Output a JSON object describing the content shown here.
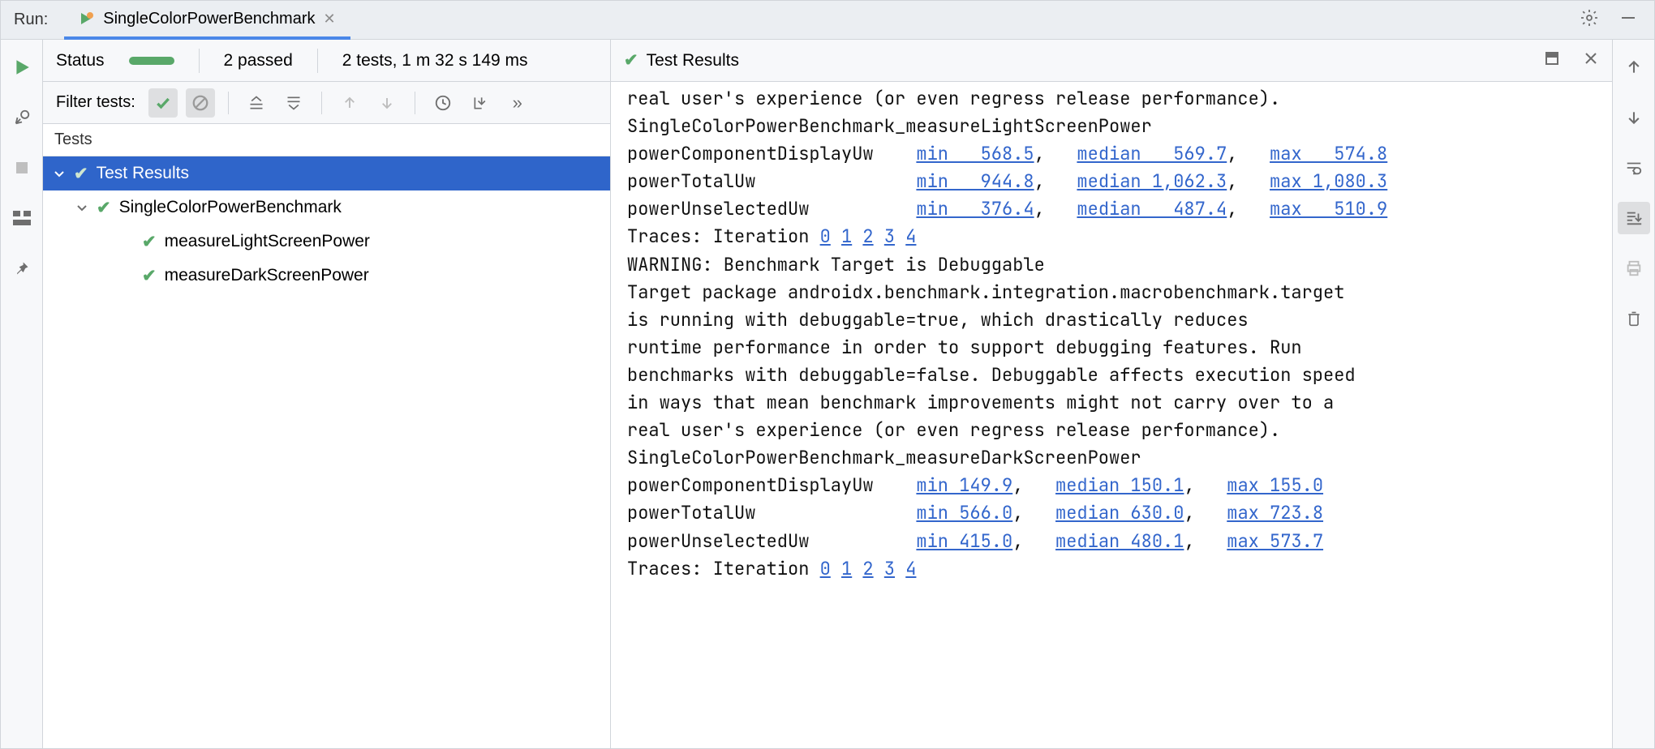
{
  "run_label": "Run:",
  "tab": {
    "title": "SingleColorPowerBenchmark"
  },
  "status": {
    "label": "Status",
    "passed": "2 passed",
    "summary": "2 tests, 1 m 32 s 149 ms"
  },
  "filter_label": "Filter tests:",
  "tests_header": "Tests",
  "tree": {
    "root": "Test Results",
    "suite": "SingleColorPowerBenchmark",
    "test1": "measureLightScreenPower",
    "test2": "measureDarkScreenPower"
  },
  "results_title": "Test Results",
  "console": {
    "intro_line": "real user's experience (or even regress release performance).",
    "light_name": "SingleColorPowerBenchmark_measureLightScreenPower",
    "light_metrics": [
      {
        "label": "powerComponentDisplayUw",
        "min": "min   568.5",
        "median": "median   569.7",
        "max": "max   574.8"
      },
      {
        "label": "powerTotalUw",
        "min": "min   944.8",
        "median": "median 1,062.3",
        "max": "max 1,080.3"
      },
      {
        "label": "powerUnselectedUw",
        "min": "min   376.4",
        "median": "median   487.4",
        "max": "max   510.9"
      }
    ],
    "traces_prefix": "Traces: Iteration ",
    "traces_links": [
      "0",
      "1",
      "2",
      "3",
      "4"
    ],
    "warning_title": "WARNING: Benchmark Target is Debuggable",
    "warning_lines": [
      "Target package androidx.benchmark.integration.macrobenchmark.target",
      "is running with debuggable=true, which drastically reduces",
      "runtime performance in order to support debugging features. Run",
      "benchmarks with debuggable=false. Debuggable affects execution speed",
      "in ways that mean benchmark improvements might not carry over to a",
      "real user's experience (or even regress release performance)."
    ],
    "dark_name": "SingleColorPowerBenchmark_measureDarkScreenPower",
    "dark_metrics": [
      {
        "label": "powerComponentDisplayUw",
        "min": "min 149.9",
        "median": "median 150.1",
        "max": "max 155.0"
      },
      {
        "label": "powerTotalUw",
        "min": "min 566.0",
        "median": "median 630.0",
        "max": "max 723.8"
      },
      {
        "label": "powerUnselectedUw",
        "min": "min 415.0",
        "median": "median 480.1",
        "max": "max 573.7"
      }
    ]
  }
}
